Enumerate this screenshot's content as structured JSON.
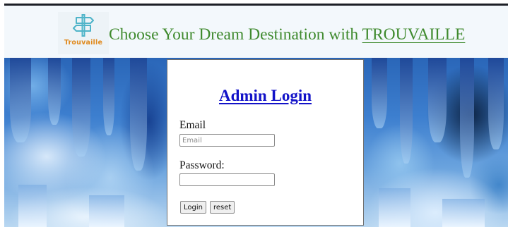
{
  "header": {
    "logo_text": "Trouvaille",
    "title_prefix": "Choose Your Dream Destination with ",
    "title_brand": "TROUVAILLE"
  },
  "login": {
    "title": "Admin Login",
    "email_label": "Email",
    "email_placeholder": "Email",
    "email_value": "",
    "password_label": "Password:",
    "password_value": "",
    "login_button": "Login",
    "reset_button": "reset"
  },
  "icons": {
    "logo": "signpost-icon"
  },
  "colors": {
    "header_bg": "#f3f8fc",
    "header_title": "#3f8a2e",
    "logo_text": "#e08a1e",
    "signpost": "#4fb4c9",
    "login_title": "#1212c8"
  }
}
